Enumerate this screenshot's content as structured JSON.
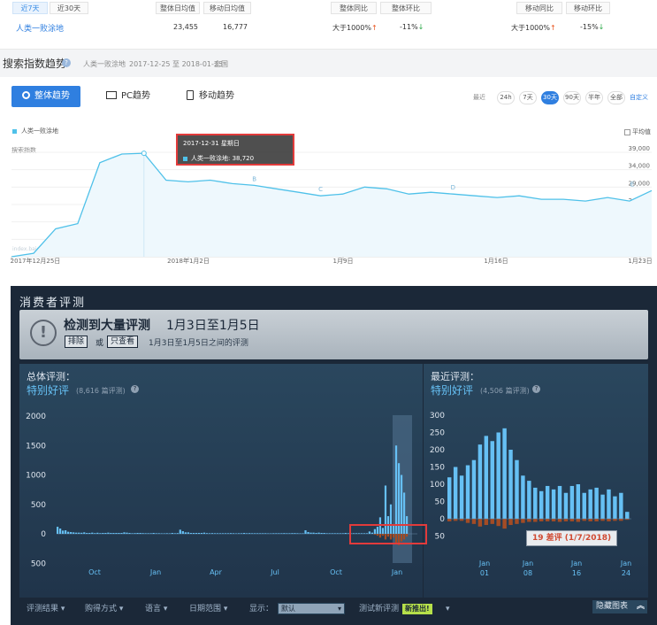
{
  "top": {
    "tab_7": "近7天",
    "tab_30": "近30天",
    "col_overall_avg": "整体日均值",
    "col_mobile_avg": "移动日均值",
    "col_overall_yoy": "整体同比",
    "col_overall_mom": "整体环比",
    "col_mobile_yoy": "移动同比",
    "col_mobile_mom": "移动环比",
    "keyword": "人类一败涂地",
    "overall_avg": "23,455",
    "mobile_avg": "16,777",
    "overall_yoy": "大于1000%",
    "overall_mom": "-11%",
    "mobile_yoy": "大于1000%",
    "mobile_mom": "-15%",
    "section_title": "搜索指数趋势",
    "section_kw": "人类一败涂地",
    "section_range": "2017-12-25 至 2018-01-23",
    "section_region": "全国",
    "tab_overall": "整体趋势",
    "tab_pc": "PC趋势",
    "tab_mobile": "移动趋势",
    "recent_label": "最近",
    "ranges": [
      "24h",
      "7天",
      "30天",
      "90天",
      "半年",
      "全部"
    ],
    "custom": "自定义",
    "legend": "人类一败涂地",
    "avg_label": "平均值",
    "y_title": "搜索指数",
    "y_ticks": [
      "39,000",
      "34,000",
      "29,000",
      "24,000",
      "19,000",
      "14,000",
      "9,000"
    ],
    "x_ticks": [
      "2017年12月25日",
      "2018年1月2日",
      "1月9日",
      "1月16日",
      "1月23日"
    ],
    "tooltip_date": "2017-12-31 星期日",
    "tooltip_value": "人类一败涂地: 38,720",
    "markers": [
      "B",
      "C",
      "D",
      "E"
    ],
    "watermark": "index.baidu.com",
    "colors": {
      "line": "#4fc1e9",
      "accent": "#2f7fe0",
      "up": "#e8541e",
      "down": "#2aa847",
      "tooltip_border": "#e23b3b"
    }
  },
  "steam": {
    "header": "消费者评测",
    "alert_title": "检测到大量评测",
    "alert_dates": "1月3日至1月5日",
    "btn_exclude": "排除",
    "or": "或",
    "btn_only": "只查看",
    "alert_desc": "1月3日至1月5日之间的评测",
    "overall_label": "总体评测：",
    "overall_rating": "特别好评",
    "overall_count": "(8,616 篇评测)",
    "recent_label": "最近评测：",
    "recent_rating": "特别好评",
    "recent_count": "(4,506 篇评测)",
    "left_y": [
      "2000",
      "1500",
      "1000",
      "500",
      "0",
      "500"
    ],
    "left_x": [
      "Oct",
      "Jan",
      "Apr",
      "Jul",
      "Oct",
      "Jan"
    ],
    "right_y": [
      "300",
      "250",
      "200",
      "150",
      "100",
      "50",
      "0",
      "50"
    ],
    "right_x": [
      [
        "Jan",
        "01"
      ],
      [
        "Jan",
        "08"
      ],
      [
        "Jan",
        "16"
      ],
      [
        "Jan",
        "24"
      ]
    ],
    "tooltip": "19 差评 (1/7/2018)",
    "filters": [
      "评测结果",
      "购得方式",
      "语言",
      "日期范围"
    ],
    "display_label": "显示：",
    "display_value": "默认",
    "test_label": "测试新评测",
    "new_badge": "新推出!",
    "hide_chart": "隐藏图表"
  },
  "chart_data": [
    {
      "type": "area",
      "title": "搜索指数趋势",
      "series": [
        {
          "name": "人类一败涂地",
          "values": [
            9000,
            10000,
            17000,
            18500,
            36000,
            38500,
            38720,
            31000,
            30500,
            31000,
            30000,
            29500,
            28500,
            27500,
            26500,
            27000,
            29000,
            28500,
            27000,
            27500,
            27000,
            26500,
            26000,
            26500,
            25500,
            25500,
            25000,
            26000,
            25000,
            28000
          ]
        }
      ],
      "x": [
        "2017-12-25",
        "2018-01-23"
      ],
      "ylim": [
        9000,
        39000
      ]
    },
    {
      "type": "bar",
      "title": "总体评测",
      "series": [
        {
          "name": "好评",
          "values": [
            120,
            90,
            55,
            60,
            35,
            30,
            25,
            20,
            20,
            18,
            25,
            15,
            15,
            20,
            12,
            18,
            12,
            15,
            15,
            20,
            15,
            15,
            15,
            15,
            15,
            25,
            20,
            15,
            10,
            12,
            15,
            15,
            12,
            10,
            10,
            10,
            15,
            10,
            10,
            8,
            8,
            10,
            8,
            15,
            10,
            12,
            70,
            45,
            25,
            25,
            15,
            15,
            15,
            15,
            15,
            20,
            12,
            10,
            12,
            10,
            10,
            10,
            10,
            10,
            10,
            12,
            10,
            8,
            10,
            10,
            15,
            10,
            12,
            10,
            10,
            10,
            10,
            10,
            10,
            8,
            8,
            10,
            10,
            10,
            10,
            12,
            10,
            10,
            12,
            12,
            10,
            8,
            8,
            60,
            30,
            20,
            20,
            15,
            20,
            15,
            15,
            10,
            10,
            10,
            10,
            10,
            10,
            10,
            15,
            10,
            8,
            10,
            10,
            10,
            10,
            10,
            10,
            40,
            20,
            80,
            120,
            280,
            100,
            820,
            300,
            500,
            150,
            1500,
            1200,
            1000,
            700,
            300
          ]
        },
        {
          "name": "差评",
          "values": [
            0,
            0,
            0,
            0,
            0,
            0,
            0,
            0,
            0,
            0,
            0,
            0,
            0,
            0,
            0,
            0,
            0,
            0,
            0,
            0,
            0,
            0,
            0,
            0,
            0,
            0,
            0,
            0,
            0,
            0,
            0,
            0,
            0,
            0,
            0,
            0,
            0,
            0,
            0,
            0,
            0,
            0,
            0,
            0,
            0,
            0,
            0,
            0,
            0,
            0,
            0,
            0,
            0,
            0,
            0,
            0,
            0,
            0,
            0,
            0,
            0,
            0,
            0,
            0,
            0,
            0,
            0,
            0,
            0,
            0,
            0,
            0,
            0,
            0,
            0,
            0,
            0,
            0,
            0,
            0,
            0,
            0,
            0,
            0,
            0,
            0,
            0,
            0,
            0,
            0,
            0,
            0,
            0,
            0,
            0,
            0,
            0,
            0,
            0,
            0,
            0,
            0,
            0,
            0,
            0,
            0,
            0,
            0,
            0,
            0,
            0,
            0,
            0,
            0,
            0,
            0,
            0,
            0,
            0,
            10,
            20,
            40,
            20,
            60,
            30,
            60,
            40,
            100,
            120,
            80,
            60,
            30
          ]
        }
      ],
      "ylim": [
        -500,
        2000
      ]
    },
    {
      "type": "bar",
      "title": "最近评测",
      "series": [
        {
          "name": "好评",
          "values": [
            120,
            150,
            125,
            155,
            170,
            215,
            240,
            225,
            250,
            262,
            200,
            170,
            125,
            110,
            90,
            80,
            95,
            85,
            95,
            75,
            95,
            100,
            75,
            85,
            90,
            70,
            85,
            65,
            75,
            20
          ]
        },
        {
          "name": "差评",
          "values": [
            5,
            4,
            4,
            8,
            10,
            15,
            12,
            10,
            14,
            19,
            12,
            10,
            8,
            6,
            6,
            5,
            5,
            5,
            6,
            5,
            5,
            6,
            4,
            5,
            5,
            4,
            5,
            4,
            4,
            2
          ]
        }
      ],
      "x": [
        "Jan 01",
        "Jan 08",
        "Jan 16",
        "Jan 24"
      ],
      "ylim": [
        -50,
        300
      ]
    }
  ]
}
